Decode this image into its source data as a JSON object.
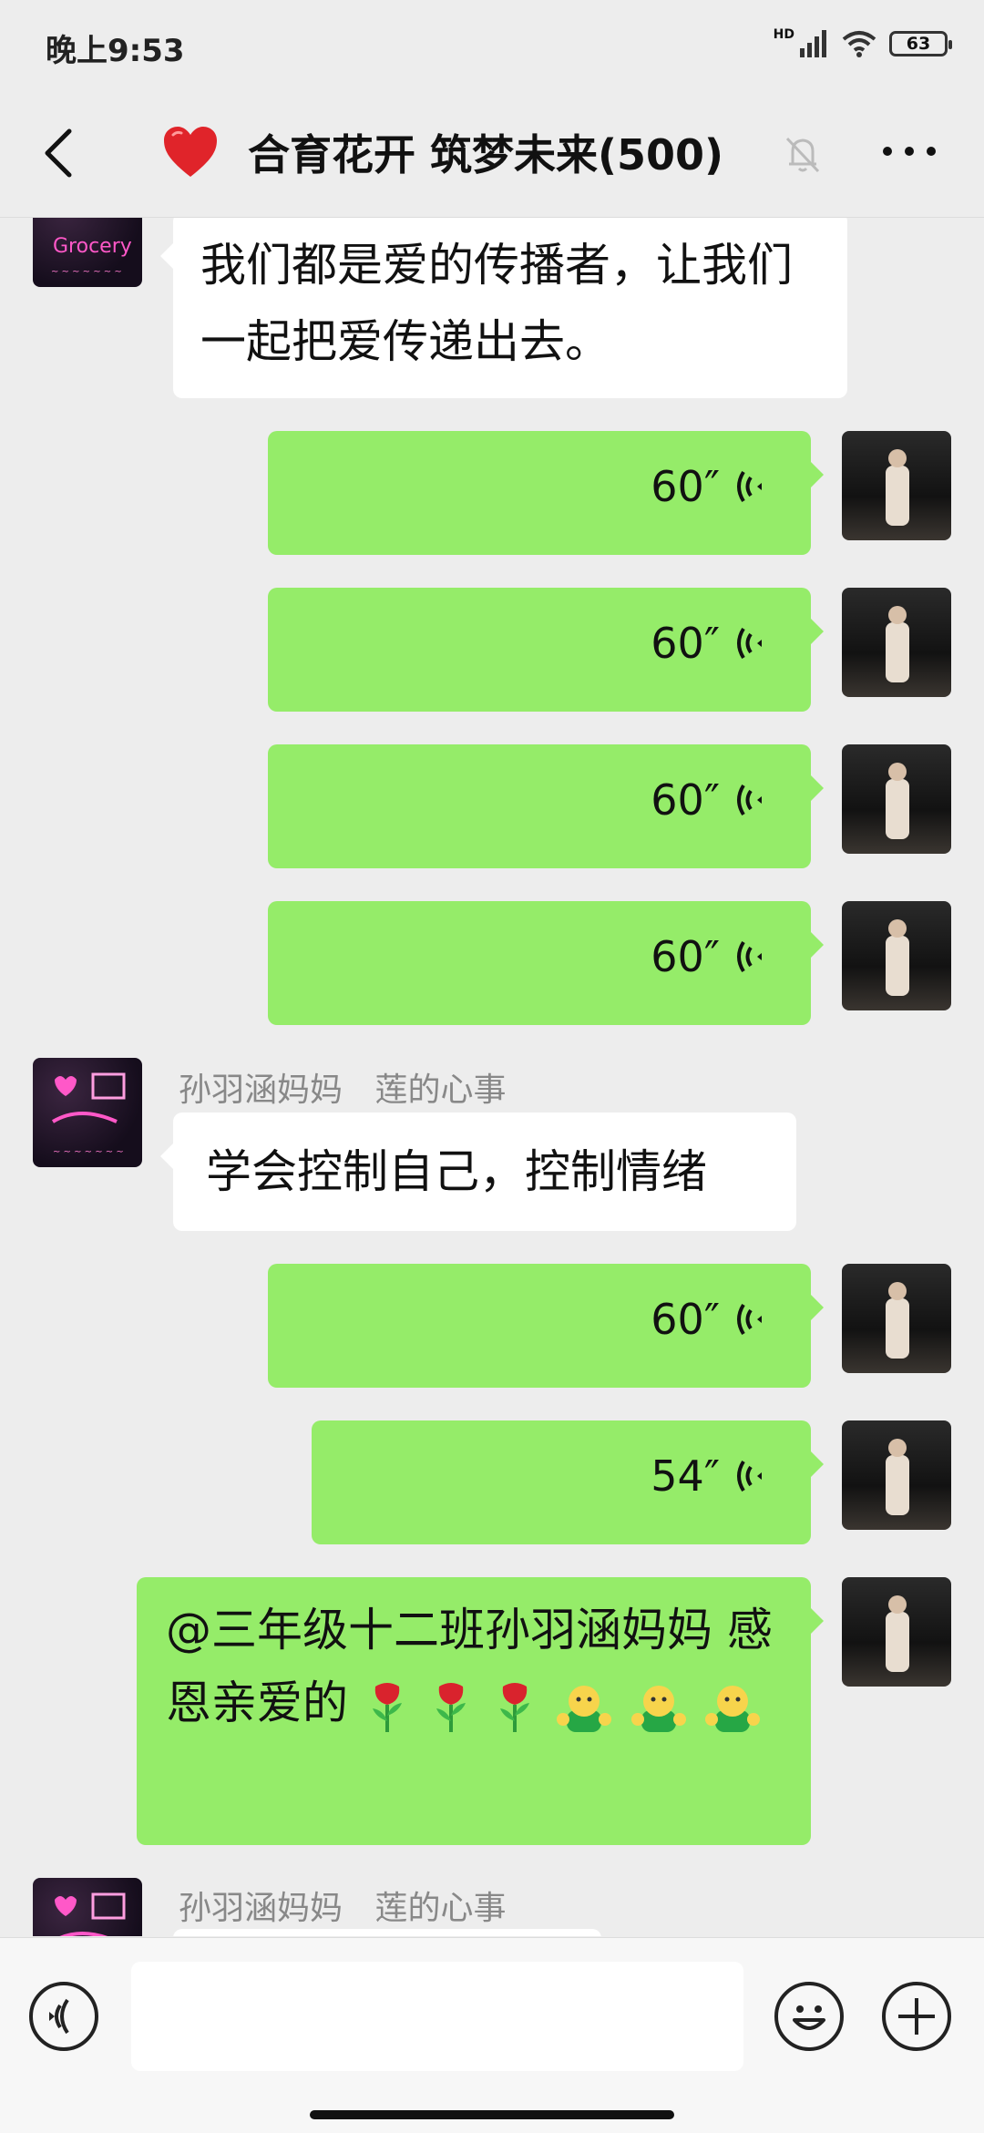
{
  "status_bar": {
    "time": "晚上9:53",
    "network": "HD",
    "battery": "63"
  },
  "header": {
    "title": "合育花开 筑梦未来(500)",
    "icons": [
      "back-icon",
      "heart-icon",
      "mute-bell-icon",
      "more-icon"
    ]
  },
  "messages": [
    {
      "side": "left",
      "text": "我们都是爱的传播者，让我们一起把爱传递出去。"
    },
    {
      "side": "right",
      "voice": "60″"
    },
    {
      "side": "right",
      "voice": "60″"
    },
    {
      "side": "right",
      "voice": "60″"
    },
    {
      "side": "right",
      "voice": "60″"
    },
    {
      "side": "left",
      "sender": "孙羽涵妈妈",
      "group_alias": "莲的心事",
      "text": "学会控制自己，控制情绪"
    },
    {
      "side": "right",
      "voice": "60″"
    },
    {
      "side": "right",
      "voice": "54″"
    },
    {
      "side": "right",
      "text": "@三年级十二班孙羽涵妈妈 感恩亲爱的",
      "emoji": [
        "rose",
        "rose",
        "rose",
        "hug",
        "hug",
        "hug"
      ]
    },
    {
      "side": "left",
      "sender": "孙羽涵妈妈",
      "group_alias": "莲的心事"
    }
  ],
  "input_bar": {
    "value": "",
    "icons": [
      "voice-input-icon",
      "emoji-icon",
      "plus-icon"
    ]
  },
  "colors": {
    "background": "#ededed",
    "my_bubble": "#95ec69",
    "their_bubble": "#ffffff",
    "muted_text": "#888888"
  }
}
